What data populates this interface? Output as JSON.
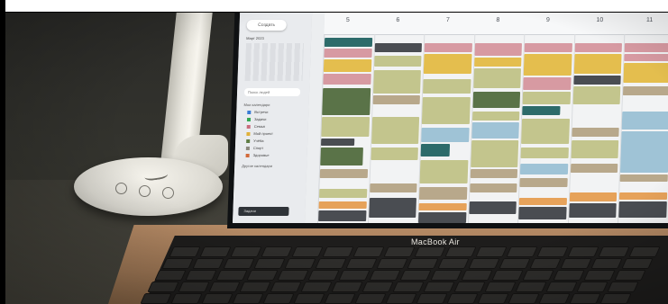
{
  "photo": {
    "subject": "MacBook Air on a desk showing a calendar app next to a white desk lamp",
    "colors": {
      "wall": "#2b2b28",
      "lamp": "#e9e7df",
      "laptop_body": "#a27a57",
      "screen_bg": "#f2f3f4"
    }
  },
  "laptop": {
    "brand": "MacBook Air"
  },
  "calendar": {
    "create_label": "Создать",
    "mini_month": "Март 2023",
    "search_placeholder": "Поиск людей",
    "my_calendars_label": "Мои календари",
    "other_calendars_label": "Другие календари",
    "todo_label": "Задачи",
    "days": [
      {
        "num": "5"
      },
      {
        "num": "6"
      },
      {
        "num": "7"
      },
      {
        "num": "8"
      },
      {
        "num": "9"
      },
      {
        "num": "10"
      },
      {
        "num": "11"
      }
    ],
    "calendars": [
      {
        "label": "Встречи",
        "color": "#3a7bd5"
      },
      {
        "label": "Задачи",
        "color": "#33a852"
      },
      {
        "label": "Семья",
        "color": "#c96b7c"
      },
      {
        "label": "Мой проект",
        "color": "#e0b13a"
      },
      {
        "label": "Учёба",
        "color": "#5e7c43"
      },
      {
        "label": "Спорт",
        "color": "#8d8a7f"
      },
      {
        "label": "Здоровье",
        "color": "#d26a3a"
      }
    ],
    "palette": {
      "green": "#5a7348",
      "olive": "#c3c58d",
      "yellow": "#e4be4e",
      "pink": "#d79aa2",
      "blue": "#9fc3d6",
      "tan": "#b8a88b",
      "dark": "#4a4d52",
      "teal": "#2d6b6a",
      "orange": "#e6a25a"
    }
  }
}
